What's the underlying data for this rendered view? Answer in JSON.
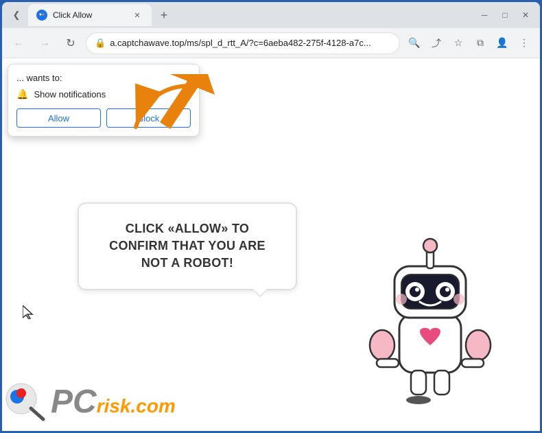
{
  "browser": {
    "title_bar": {
      "tab_title": "Click Allow",
      "new_tab_label": "+",
      "minimize_label": "─",
      "maximize_label": "□",
      "close_label": "✕",
      "chevron_label": "❮",
      "menu_dots": "⋮"
    },
    "nav_bar": {
      "back_label": "←",
      "forward_label": "→",
      "refresh_label": "↻",
      "url": "a.captchawave.top/ms/spl_d_rtt_A/?c=6aeba482-275f-4128-a7c...",
      "search_label": "🔍",
      "share_label": "⤴",
      "bookmark_label": "☆",
      "split_label": "⧉",
      "profile_label": "👤"
    }
  },
  "popup": {
    "wants_text": "... wants to:",
    "permission_text": "Show notifications",
    "allow_label": "Allow",
    "block_label": "Block",
    "close_label": "×"
  },
  "page": {
    "message": "CLICK «ALLOW» TO CONFIRM THAT YOU ARE NOT A ROBOT!",
    "pcrisk_text": "PC",
    "pcrisk_suffix": "risk.com"
  },
  "colors": {
    "accent_blue": "#1a73e8",
    "browser_bg": "#dee1e6",
    "arrow_orange": "#e8820c"
  }
}
